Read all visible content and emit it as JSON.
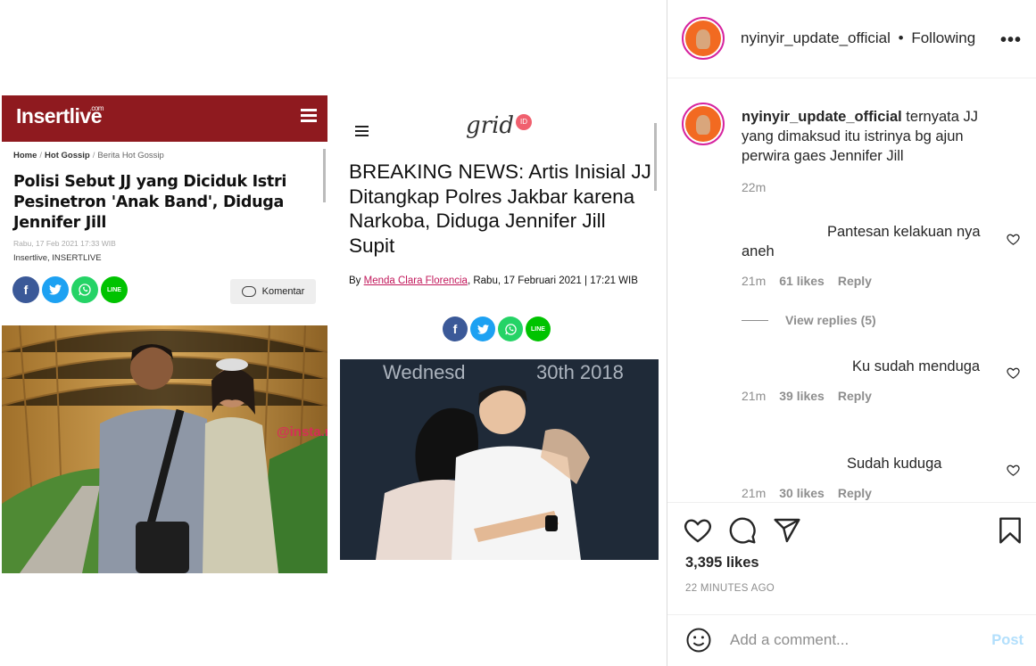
{
  "panel_insertlive": {
    "logo": "Insertlive",
    "logo_sup": ".com",
    "breadcrumb": {
      "home": "Home",
      "section": "Hot Gossip",
      "sub": "Berita Hot Gossip"
    },
    "title": "Polisi Sebut JJ yang Diciduk Istri Pesinetron 'Anak Band', Diduga Jennifer Jill",
    "date": "Rabu, 17 Feb 2021 17:33 WIB",
    "source": "Insertlive, INSERTLIVE",
    "share": {
      "fb": "f",
      "tw": "t",
      "wa": "w",
      "line": "LINE"
    },
    "comment_button": "Komentar",
    "watermark": "@insta.nyinyir"
  },
  "panel_grid": {
    "logo": "grid",
    "logo_badge": "ID",
    "title": "BREAKING NEWS: Artis Inisial JJ Ditangkap Polres Jakbar karena Narkoba, Diduga Jennifer Jill Supit",
    "byline_prefix": "By ",
    "author": "Menda Clara Florencia",
    "byline_suffix": ", Rabu, 17 Februari 2021 | 17:21 WIB",
    "backdrop_text": "Wednesd",
    "backdrop_text2": "30th 2018",
    "share": {
      "fb": "f",
      "tw": "t",
      "wa": "w",
      "line": "LINE"
    }
  },
  "sidebar": {
    "header": {
      "username": "nyinyir_update_official",
      "dot": "•",
      "follow_status": "Following",
      "more": "•••"
    },
    "caption": {
      "username": "nyinyir_update_official",
      "text": " ternyata JJ yang dimaksud itu istrinya bg ajun perwira gaes Jennifer Jill",
      "time": "22m"
    },
    "comments": [
      {
        "text": "Pantesan kelakuan nya aneh",
        "time": "21m",
        "likes": "61 likes",
        "reply": "Reply"
      },
      {
        "text": "Ku sudah menduga",
        "time": "21m",
        "likes": "39 likes",
        "reply": "Reply"
      },
      {
        "text": "Sudah kuduga",
        "time": "21m",
        "likes": "30 likes",
        "reply": "Reply"
      }
    ],
    "view_replies": "View replies (5)",
    "likes_count": "3,395 likes",
    "posted_ago": "22 MINUTES AGO",
    "add_comment_placeholder": "Add a comment...",
    "post_label": "Post"
  }
}
